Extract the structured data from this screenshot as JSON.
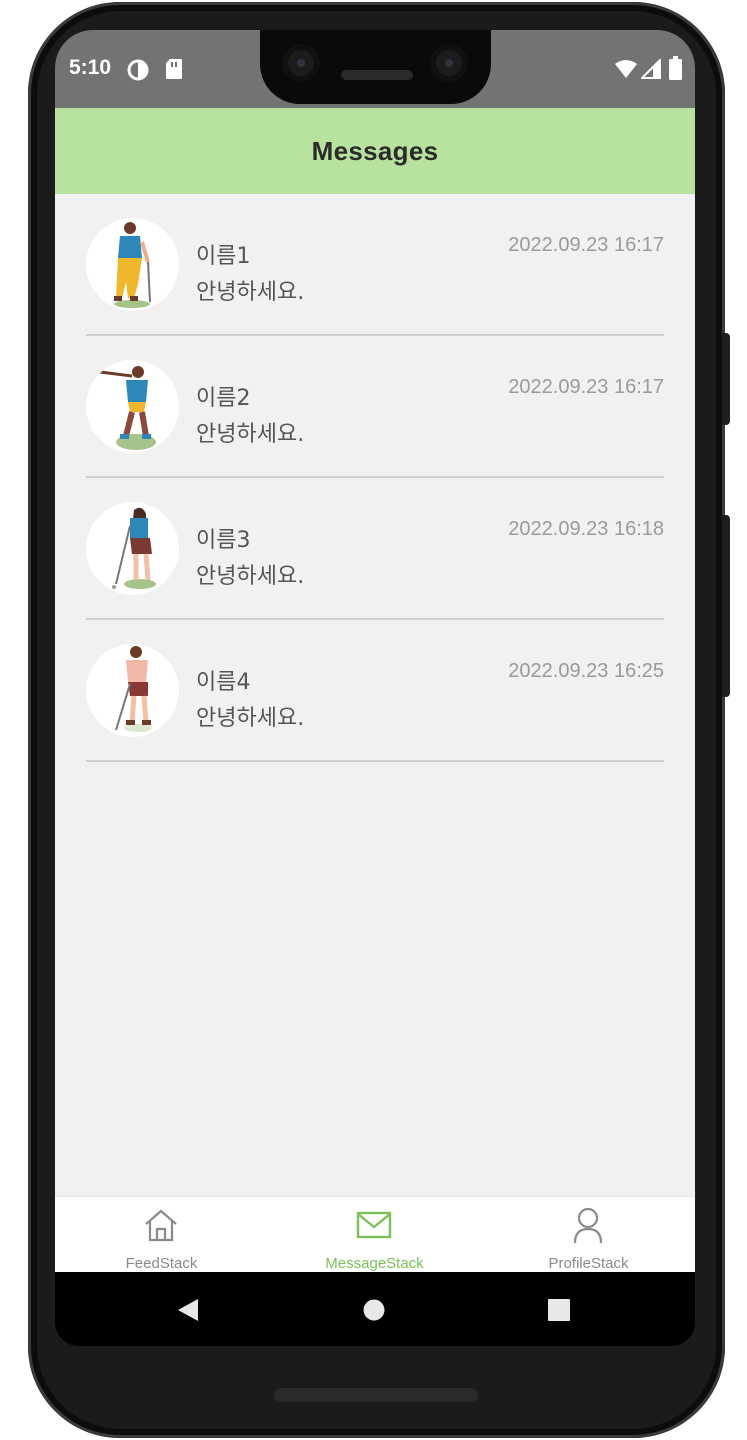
{
  "status_bar": {
    "time": "5:10",
    "left_icons": [
      "data-saver-icon",
      "sd-card-icon"
    ],
    "right_icons": [
      "wifi-icon",
      "cellular-signal-icon",
      "battery-icon"
    ]
  },
  "header": {
    "title": "Messages"
  },
  "messages": [
    {
      "name": "이름1",
      "text": "안녕하세요.",
      "time": "2022.09.23 16:17",
      "avatar": "golfer-avatar-1"
    },
    {
      "name": "이름2",
      "text": "안녕하세요.",
      "time": "2022.09.23 16:17",
      "avatar": "golfer-avatar-2"
    },
    {
      "name": "이름3",
      "text": "안녕하세요.",
      "time": "2022.09.23 16:18",
      "avatar": "golfer-avatar-3"
    },
    {
      "name": "이름4",
      "text": "안녕하세요.",
      "time": "2022.09.23 16:25",
      "avatar": "golfer-avatar-4"
    }
  ],
  "tabbar": {
    "tabs": [
      {
        "label": "FeedStack",
        "icon": "home-icon",
        "active": false
      },
      {
        "label": "MessageStack",
        "icon": "mail-icon",
        "active": true
      },
      {
        "label": "ProfileStack",
        "icon": "user-icon",
        "active": false
      }
    ]
  },
  "nav_bar": {
    "icons": [
      "back-icon",
      "home-circle-icon",
      "recents-icon"
    ]
  },
  "colors": {
    "header_bg": "#b7e39f",
    "active_tab": "#7cc05a",
    "inactive_tab": "#8a8a8a",
    "content_bg": "#f1f1f1",
    "status_bar_bg": "#737373"
  }
}
